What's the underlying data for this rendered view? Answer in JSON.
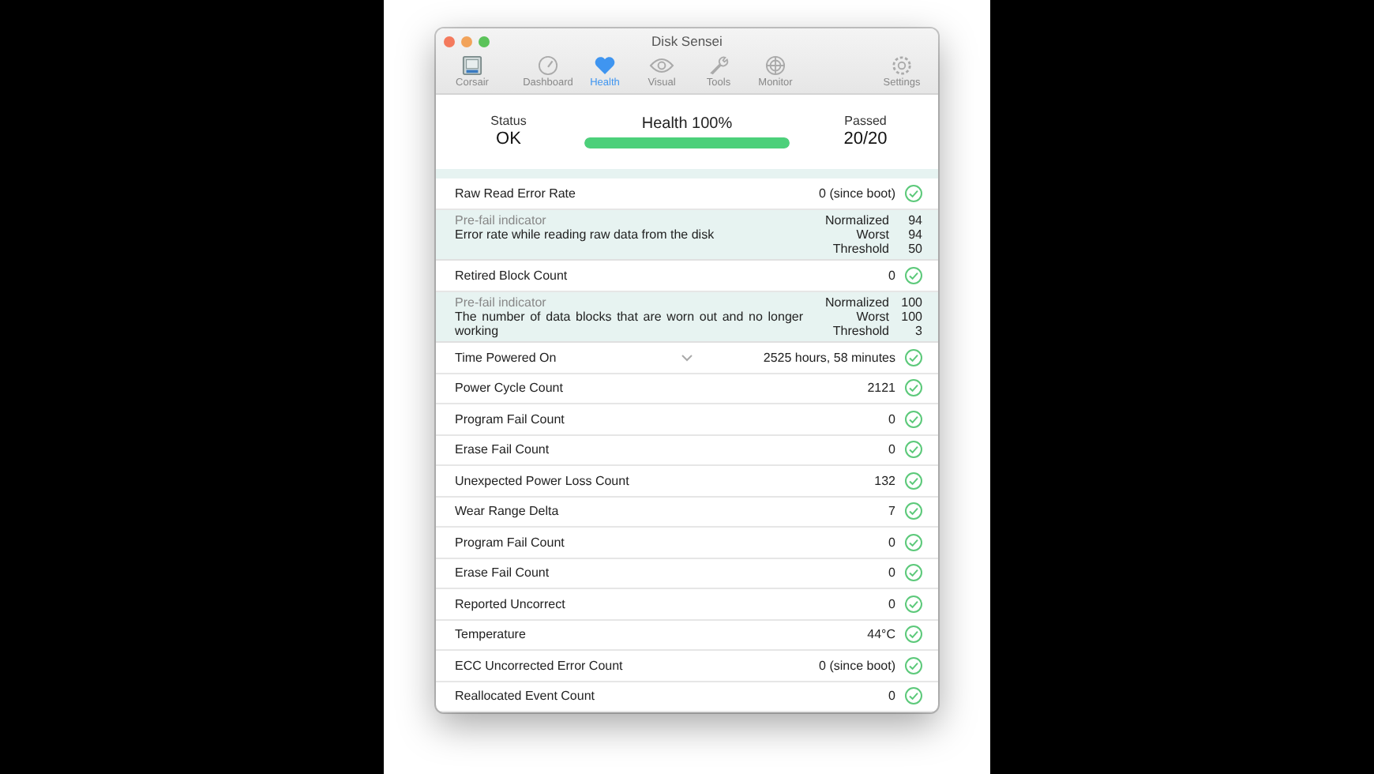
{
  "window": {
    "title": "Disk Sensei"
  },
  "toolbar": [
    {
      "label": "Corsair",
      "kind": "device",
      "selected": false
    },
    {
      "label": "Dashboard",
      "kind": "tab",
      "selected": false
    },
    {
      "label": "Health",
      "kind": "tab",
      "selected": true
    },
    {
      "label": "Visual",
      "kind": "tab",
      "selected": false
    },
    {
      "label": "Tools",
      "kind": "tab",
      "selected": false
    },
    {
      "label": "Monitor",
      "kind": "tab",
      "selected": false
    },
    {
      "label": "Settings",
      "kind": "settings",
      "selected": false
    }
  ],
  "summary": {
    "status_label": "Status",
    "status": "OK",
    "health_label": "Health 100%",
    "level": 1.0,
    "passed_label": "Passed",
    "passed": "20/20"
  },
  "rows": [
    {
      "kind": "attribute",
      "name": "Raw Read Error Rate",
      "value": "0 (since boot)",
      "ok": true,
      "expand_hint": false
    },
    {
      "kind": "detail",
      "indicator": "Pre-fail indicator",
      "description": "Error rate while reading raw data from the disk",
      "metrics": [
        {
          "label": "Normalized",
          "value": "94"
        },
        {
          "label": "Worst",
          "value": "94"
        },
        {
          "label": "Threshold",
          "value": "50"
        }
      ]
    },
    {
      "kind": "attribute",
      "name": "Retired Block Count",
      "value": "0",
      "ok": true,
      "expand_hint": false
    },
    {
      "kind": "detail",
      "indicator": "Pre-fail indicator",
      "description": "The number of data blocks that are worn out and no longer working",
      "metrics": [
        {
          "label": "Normalized",
          "value": "100"
        },
        {
          "label": "Worst",
          "value": "100"
        },
        {
          "label": "Threshold",
          "value": "3"
        }
      ]
    },
    {
      "kind": "attribute",
      "name": "Time Powered On",
      "value": "2525 hours, 58 minutes",
      "ok": true,
      "expand_hint": true
    },
    {
      "kind": "attribute",
      "name": "Power Cycle Count",
      "value": "2121",
      "ok": true,
      "expand_hint": false
    },
    {
      "kind": "attribute",
      "name": "Program Fail Count",
      "value": "0",
      "ok": true,
      "expand_hint": false
    },
    {
      "kind": "attribute",
      "name": "Erase Fail Count",
      "value": "0",
      "ok": true,
      "expand_hint": false
    },
    {
      "kind": "attribute",
      "name": "Unexpected Power Loss Count",
      "value": "132",
      "ok": true,
      "expand_hint": false
    },
    {
      "kind": "attribute",
      "name": "Wear Range Delta",
      "value": "7",
      "ok": true,
      "expand_hint": false
    },
    {
      "kind": "attribute",
      "name": "Program Fail Count",
      "value": "0",
      "ok": true,
      "expand_hint": false
    },
    {
      "kind": "attribute",
      "name": "Erase Fail Count",
      "value": "0",
      "ok": true,
      "expand_hint": false
    },
    {
      "kind": "attribute",
      "name": "Reported Uncorrect",
      "value": "0",
      "ok": true,
      "expand_hint": false
    },
    {
      "kind": "attribute",
      "name": "Temperature",
      "value": "44°C",
      "ok": true,
      "expand_hint": false
    },
    {
      "kind": "attribute",
      "name": "ECC Uncorrected Error Count",
      "value": "0 (since boot)",
      "ok": true,
      "expand_hint": false
    },
    {
      "kind": "attribute",
      "name": "Reallocated Event Count",
      "value": "0",
      "ok": true,
      "expand_hint": false
    }
  ]
}
